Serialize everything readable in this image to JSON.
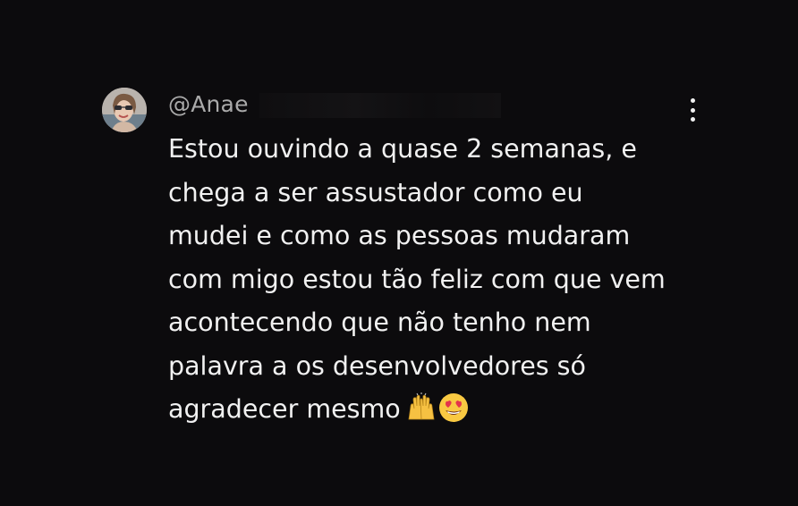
{
  "comment": {
    "username": "@Anae",
    "text_lines": [
      "Estou ouvindo a quase 2 semanas, e",
      "chega a ser assustador como eu",
      "mudei e como as pessoas mudaram",
      "com migo estou tão feliz com que vem",
      "acontecendo que não tenho nem",
      "palavra a os desenvolvedores só",
      "agradecer mesmo"
    ],
    "emojis": [
      "raising-hands-emoji",
      "heart-eyes-emoji"
    ]
  },
  "icons": {
    "menu": "more-vertical-icon",
    "avatar": "user-avatar"
  },
  "colors": {
    "background": "#0c0b0d",
    "text": "#f1f1f1",
    "username": "#aaaaaa"
  }
}
